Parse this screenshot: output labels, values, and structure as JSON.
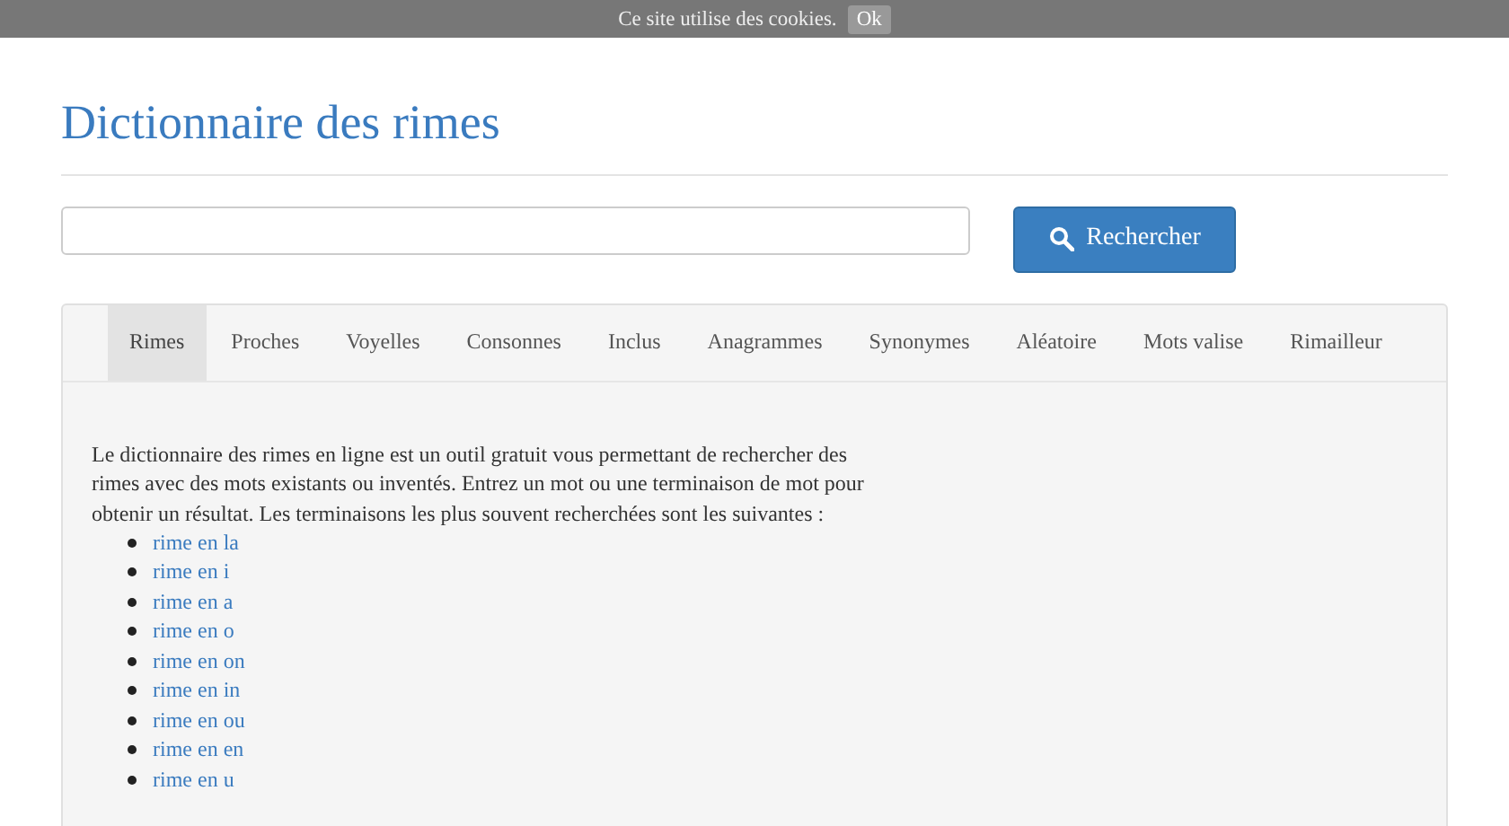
{
  "cookie_bar": {
    "text": "Ce site utilise des cookies.",
    "button": "Ok"
  },
  "site_title": "Dictionnaire des rimes",
  "search": {
    "button": "Rechercher"
  },
  "tabs": [
    {
      "label": "Rimes",
      "selected": true
    },
    {
      "label": "Proches",
      "selected": false
    },
    {
      "label": "Voyelles",
      "selected": false
    },
    {
      "label": "Consonnes",
      "selected": false
    },
    {
      "label": "Inclus",
      "selected": false
    },
    {
      "label": "Anagrammes",
      "selected": false
    },
    {
      "label": "Synonymes",
      "selected": false
    },
    {
      "label": "Aléatoire",
      "selected": false
    },
    {
      "label": "Mots valise",
      "selected": false
    },
    {
      "label": "Rimailleur",
      "selected": false
    }
  ],
  "intro": "Le dictionnaire des rimes en ligne est un outil gratuit vous permettant de rechercher des rimes avec des mots existants ou inventés. Entrez un mot ou une terminaison de mot pour obtenir un résultat. Les terminaisons les plus souvent recherchées sont les suivantes :",
  "links": [
    "rime en la",
    "rime en i",
    "rime en a",
    "rime en o",
    "rime en on",
    "rime en in",
    "rime en ou",
    "rime en en",
    "rime en u"
  ]
}
